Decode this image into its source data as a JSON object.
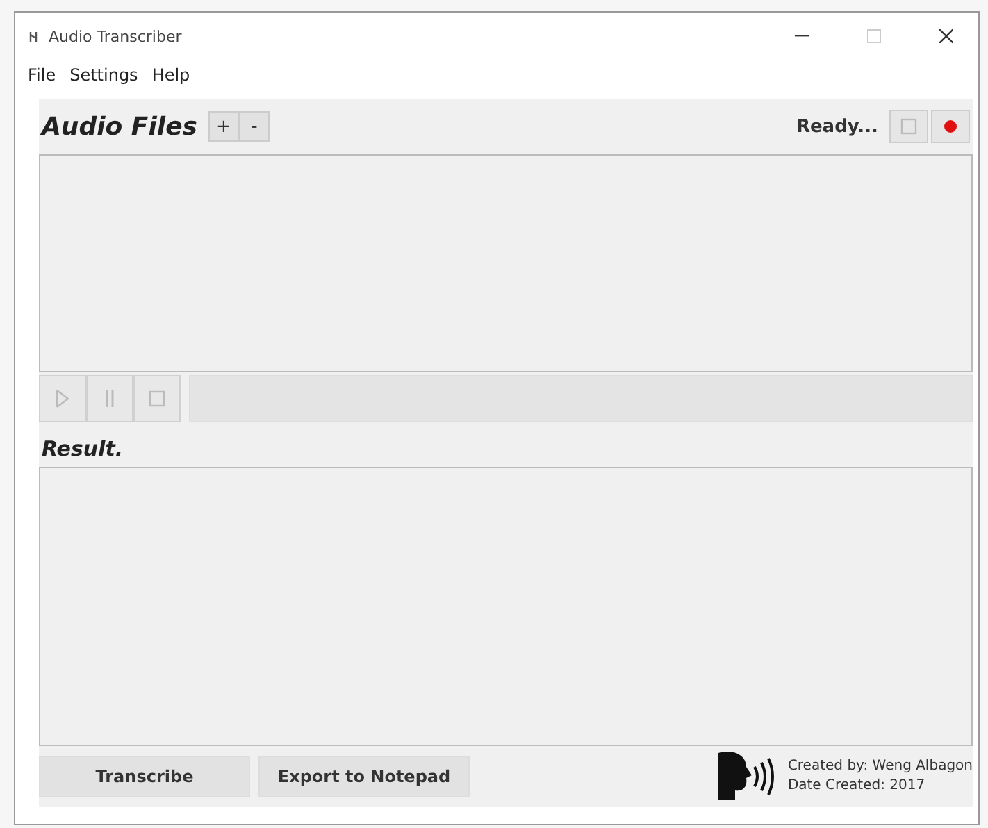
{
  "window": {
    "title": "Audio Transcriber"
  },
  "menu": [
    "File",
    "Settings",
    "Help"
  ],
  "audio_files": {
    "title": "Audio Files",
    "add": "+",
    "remove": "-",
    "status": "Ready...",
    "recorder": [
      {
        "kind": "stop",
        "disabled": true
      },
      {
        "kind": "record",
        "disabled": false
      }
    ]
  },
  "player": [
    {
      "kind": "play",
      "disabled": true
    },
    {
      "kind": "pause",
      "disabled": true
    },
    {
      "kind": "stop",
      "disabled": true
    }
  ],
  "result": {
    "title": "Result."
  },
  "buttons": [
    "Transcribe",
    "Export to Notepad"
  ],
  "credits": [
    "Created by: Weng Albagon",
    "Date Created: 2017"
  ]
}
